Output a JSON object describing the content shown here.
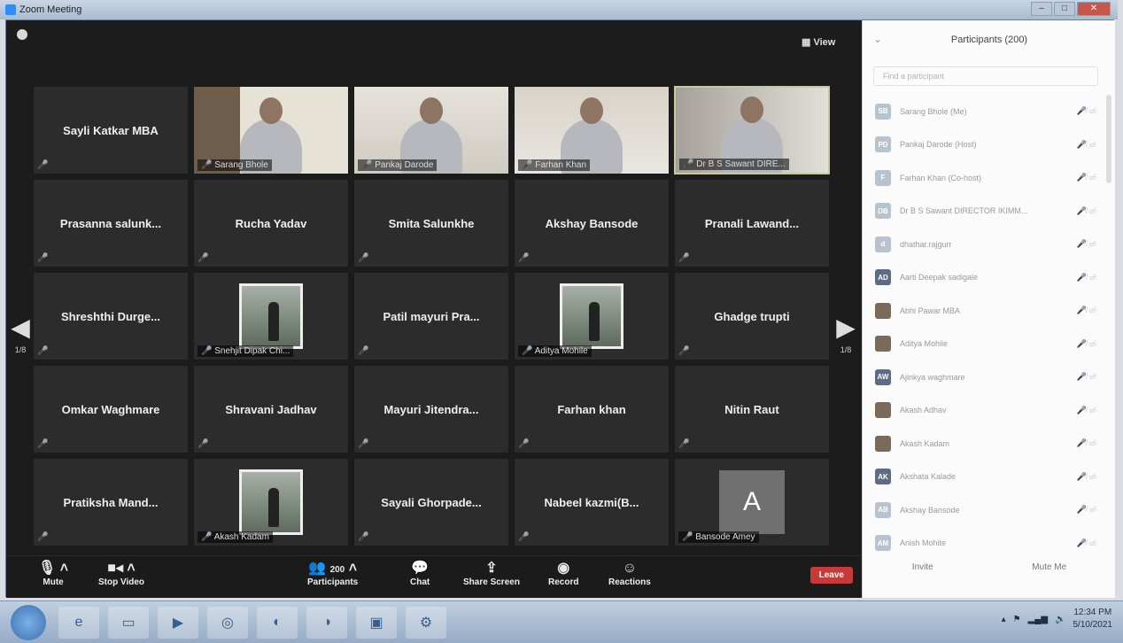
{
  "window": {
    "title": "Zoom Meeting"
  },
  "stage": {
    "view_label": "View"
  },
  "paging": {
    "left": "1/8",
    "right": "1/8"
  },
  "tiles": [
    {
      "name": "Sayli Katkar MBA",
      "kind": "name"
    },
    {
      "name": "Sarang Bhole",
      "kind": "video"
    },
    {
      "name": "Pankaj Darode",
      "kind": "video"
    },
    {
      "name": "Farhan Khan",
      "kind": "video"
    },
    {
      "name": "Dr B S Sawant DIRE...",
      "kind": "video",
      "active": true
    },
    {
      "name": "Prasanna salunk...",
      "kind": "name"
    },
    {
      "name": "Rucha Yadav",
      "kind": "name"
    },
    {
      "name": "Smita Salunkhe",
      "kind": "name"
    },
    {
      "name": "Akshay Bansode",
      "kind": "name"
    },
    {
      "name": "Pranali Lawand...",
      "kind": "name"
    },
    {
      "name": "Shreshthi Durge...",
      "kind": "name"
    },
    {
      "name": "Snehjit Dipak Chi...",
      "kind": "photo"
    },
    {
      "name": "Patil mayuri Pra...",
      "kind": "name"
    },
    {
      "name": "Aditya Mohile",
      "kind": "photo"
    },
    {
      "name": "Ghadge trupti",
      "kind": "name"
    },
    {
      "name": "Omkar Waghmare",
      "kind": "name"
    },
    {
      "name": "Shravani Jadhav",
      "kind": "name"
    },
    {
      "name": "Mayuri Jitendra...",
      "kind": "name"
    },
    {
      "name": "Farhan khan",
      "kind": "name"
    },
    {
      "name": "Nitin Raut",
      "kind": "name"
    },
    {
      "name": "Pratiksha Mand...",
      "kind": "name"
    },
    {
      "name": "Akash Kadam",
      "kind": "photo"
    },
    {
      "name": "Sayali Ghorpade...",
      "kind": "name"
    },
    {
      "name": "Nabeel kazmi(B...",
      "kind": "name"
    },
    {
      "name": "Bansode Amey",
      "kind": "avatar",
      "letter": "A"
    }
  ],
  "toolbar": {
    "mute": "Mute",
    "stop_video": "Stop Video",
    "participants": "Participants",
    "participants_count": "200",
    "chat": "Chat",
    "share_screen": "Share Screen",
    "record": "Record",
    "reactions": "Reactions",
    "leave": "Leave"
  },
  "panel": {
    "title": "Participants (200)",
    "search_placeholder": "Find a participant",
    "participants": [
      {
        "initials": "SB",
        "name": "Sarang Bhole (Me)"
      },
      {
        "initials": "PD",
        "name": "Pankaj Darode (Host)"
      },
      {
        "initials": "F",
        "name": "Farhan Khan (Co-host)"
      },
      {
        "initials": "DB",
        "name": "Dr B S Sawant DIRECTOR IKIMM..."
      },
      {
        "initials": "d",
        "name": "dhathar.rajgurr"
      },
      {
        "initials": "AD",
        "name": "Aarti Deepak sadigale",
        "style": "dark"
      },
      {
        "initials": "",
        "name": "Abhi Pawar MBA",
        "style": "pic"
      },
      {
        "initials": "",
        "name": "Aditya Mohile",
        "style": "pic"
      },
      {
        "initials": "AW",
        "name": "Ajinkya waghmare",
        "style": "dark"
      },
      {
        "initials": "",
        "name": "Akash Adhav",
        "style": "pic"
      },
      {
        "initials": "",
        "name": "Akash Kadam",
        "style": "pic"
      },
      {
        "initials": "AK",
        "name": "Akshata Kalade",
        "style": "dark"
      },
      {
        "initials": "AB",
        "name": "Akshay Bansode"
      },
      {
        "initials": "AM",
        "name": "Anish Mohite"
      }
    ],
    "invite": "Invite",
    "mute_me": "Mute Me"
  },
  "taskbar": {
    "time": "12:34 PM",
    "date": "5/10/2021"
  }
}
